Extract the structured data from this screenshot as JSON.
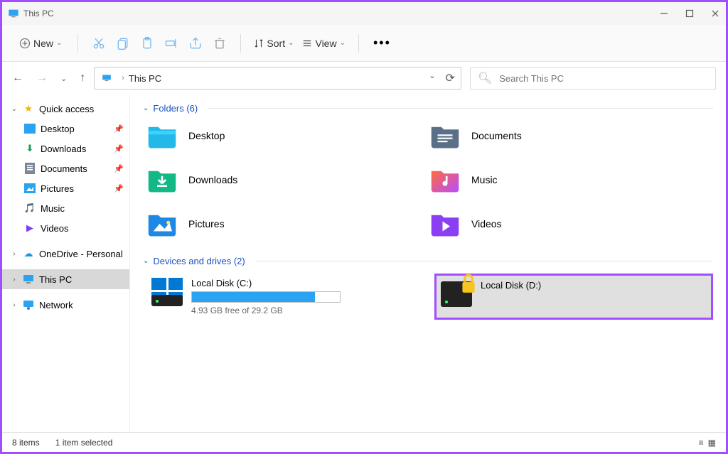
{
  "window": {
    "title": "This PC"
  },
  "toolbar": {
    "new_label": "New",
    "sort_label": "Sort",
    "view_label": "View"
  },
  "address": {
    "breadcrumb": "This PC",
    "search_placeholder": "Search This PC"
  },
  "tree": {
    "quick_access": "Quick access",
    "desktop": "Desktop",
    "downloads": "Downloads",
    "documents": "Documents",
    "pictures": "Pictures",
    "music": "Music",
    "videos": "Videos",
    "onedrive": "OneDrive - Personal",
    "this_pc": "This PC",
    "network": "Network"
  },
  "groups": {
    "folders_header": "Folders (6)",
    "drives_header": "Devices and drives (2)"
  },
  "folders": {
    "desktop": "Desktop",
    "documents": "Documents",
    "downloads": "Downloads",
    "music": "Music",
    "pictures": "Pictures",
    "videos": "Videos"
  },
  "drives": {
    "c": {
      "name": "Local Disk (C:)",
      "free_text": "4.93 GB free of 29.2 GB",
      "used_pct": 83
    },
    "d": {
      "name": "Local Disk (D:)"
    }
  },
  "status": {
    "items": "8 items",
    "selected": "1 item selected"
  }
}
